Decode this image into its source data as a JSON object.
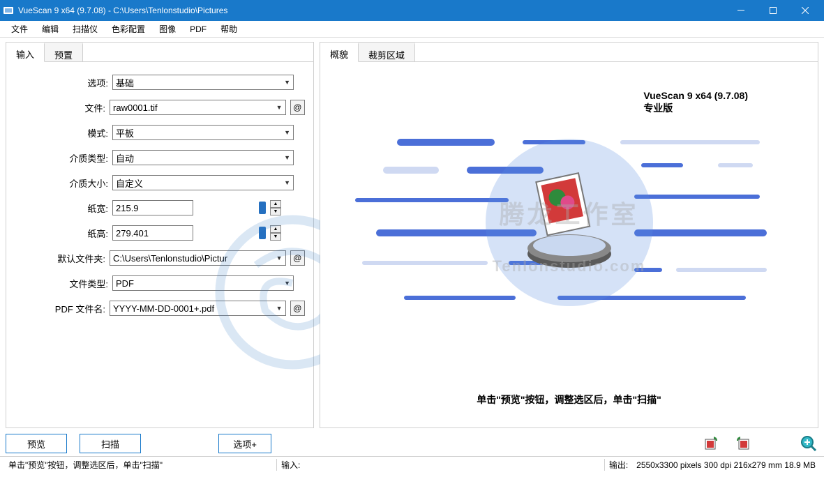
{
  "title": "VueScan 9 x64 (9.7.08) - C:\\Users\\Tenlonstudio\\Pictures",
  "menu": [
    "文件",
    "编辑",
    "扫描仪",
    "色彩配置",
    "图像",
    "PDF",
    "帮助"
  ],
  "left": {
    "tabs": {
      "input": "输入",
      "preset": "预置"
    },
    "labels": {
      "options": "选项:",
      "file": "文件:",
      "mode": "模式:",
      "media_type": "介质类型:",
      "media_size": "介质大小:",
      "paper_width": "纸宽:",
      "paper_height": "纸高:",
      "default_folder": "默认文件夹:",
      "file_type": "文件类型:",
      "pdf_filename": "PDF 文件名:"
    },
    "values": {
      "options": "基础",
      "file": "raw0001.tif",
      "mode": "平板",
      "media_type": "自动",
      "media_size": "自定义",
      "paper_width": "215.9",
      "paper_height": "279.401",
      "default_folder": "C:\\Users\\Tenlonstudio\\Pictur",
      "file_type": "PDF",
      "pdf_filename": "YYYY-MM-DD-0001+.pdf"
    },
    "at": "@"
  },
  "right": {
    "tabs": {
      "overview": "概貌",
      "crop": "裁剪区域"
    },
    "title1": "VueScan 9 x64 (9.7.08)",
    "title2": "专业版",
    "hint": "单击\"预览\"按钮，调整选区后，单击\"扫描\"",
    "watermark_line1": "腾龙工作室",
    "watermark_line2": "Tenlonstudio.com"
  },
  "buttons": {
    "preview": "预览",
    "scan": "扫描",
    "options_plus": "选项+"
  },
  "status": {
    "left": "单击\"预览\"按钮，调整选区后，单击\"扫描\"",
    "input_label": "输入:",
    "output_label": "输出:",
    "output_value": "2550x3300 pixels 300 dpi 216x279 mm 18.9 MB"
  }
}
